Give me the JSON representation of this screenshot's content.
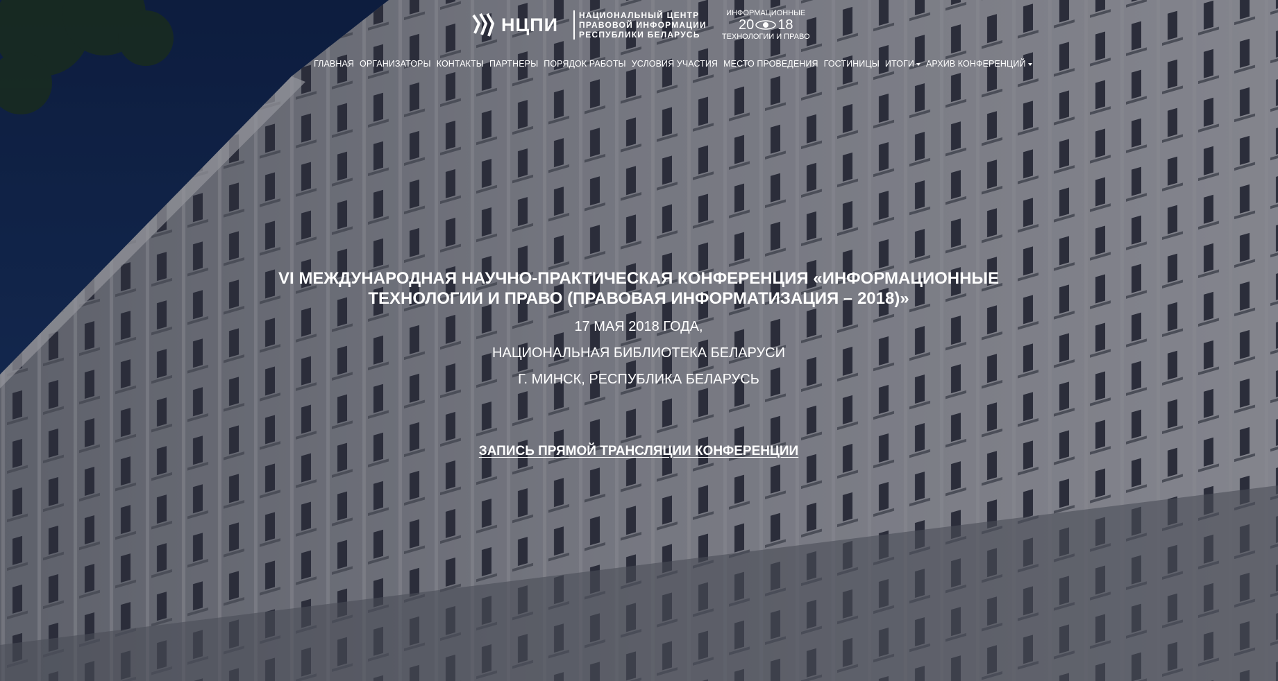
{
  "brand": {
    "logo_text": "НЦПИ",
    "org_lines": [
      "НАЦИОНАЛЬНЫЙ ЦЕНТР",
      "ПРАВОВОЙ ИНФОРМАЦИИ",
      "РЕСПУБЛИКИ БЕЛАРУСЬ"
    ],
    "conf_top": "ИНФОРМАЦИОННЫЕ",
    "conf_year_left": "20",
    "conf_year_right": "18",
    "conf_bottom": "ТЕХНОЛОГИИ И ПРАВО"
  },
  "nav": {
    "items": [
      "ГЛАВНАЯ",
      "ОРГАНИЗАТОРЫ",
      "КОНТАКТЫ",
      "ПАРТНЕРЫ",
      "ПОРЯДОК РАБОТЫ",
      "УСЛОВИЯ УЧАСТИЯ",
      "МЕСТО ПРОВЕДЕНИЯ",
      "ГОСТИНИЦЫ",
      "ИТОГИ",
      "АРХИВ КОНФЕРЕНЦИЙ"
    ]
  },
  "hero": {
    "title_line1": "VI МЕЖДУНАРОДНАЯ НАУЧНО-ПРАКТИЧЕСКАЯ КОНФЕРЕНЦИЯ «ИНФОРМАЦИОННЫЕ",
    "title_line2": "ТЕХНОЛОГИИ И ПРАВО (ПРАВОВАЯ ИНФОРМАТИЗАЦИЯ – 2018)»",
    "date": "17 МАЯ 2018 ГОДА,",
    "venue": "НАЦИОНАЛЬНАЯ БИБЛИОТЕКА БЕЛАРУСИ",
    "city": "Г. МИНСК, РЕСПУБЛИКА БЕЛАРУСЬ",
    "recording_link": "ЗАПИСЬ ПРЯМОЙ ТРАНСЛЯЦИИ КОНФЕРЕНЦИИ"
  },
  "colors": {
    "sky": "#0d2a5e",
    "facade": "#bcbcc4",
    "overlay": "#121622"
  }
}
